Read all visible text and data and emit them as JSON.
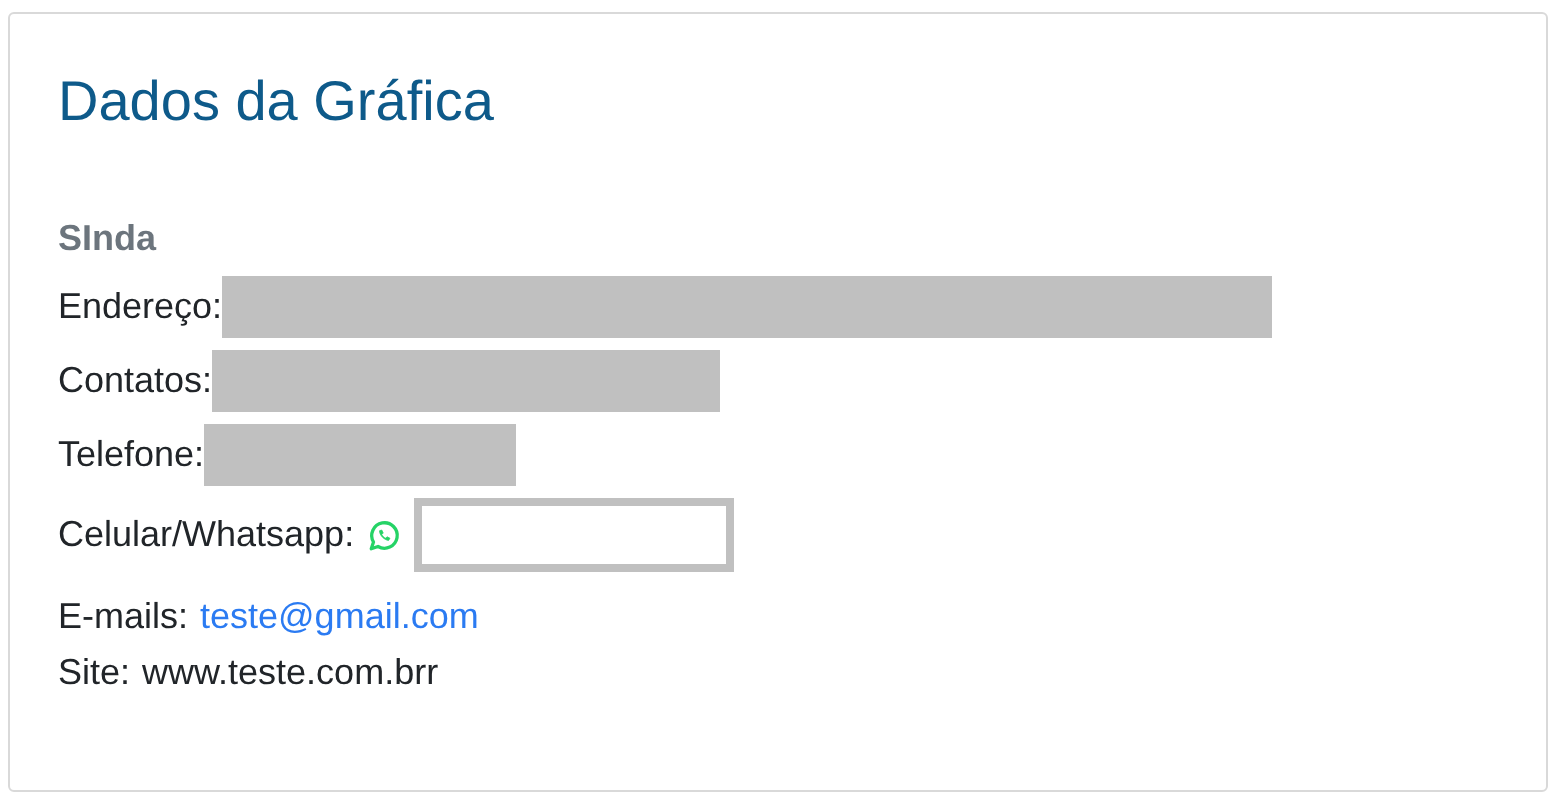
{
  "card": {
    "title": "Dados da Gráfica",
    "company_name": "SInda",
    "rows": [
      {
        "kind": "redacted",
        "label": "Endereço:"
      },
      {
        "kind": "redacted",
        "label": "Contatos:"
      },
      {
        "kind": "redacted",
        "label": "Telefone:"
      },
      {
        "kind": "whatsapp",
        "label": "Celular/Whatsapp:"
      }
    ],
    "contacts": [
      {
        "kind": "link",
        "label": "E-mails:",
        "value": "teste@gmail.com"
      },
      {
        "kind": "text",
        "label": "Site:",
        "value": "www.teste.com.brr"
      }
    ]
  }
}
